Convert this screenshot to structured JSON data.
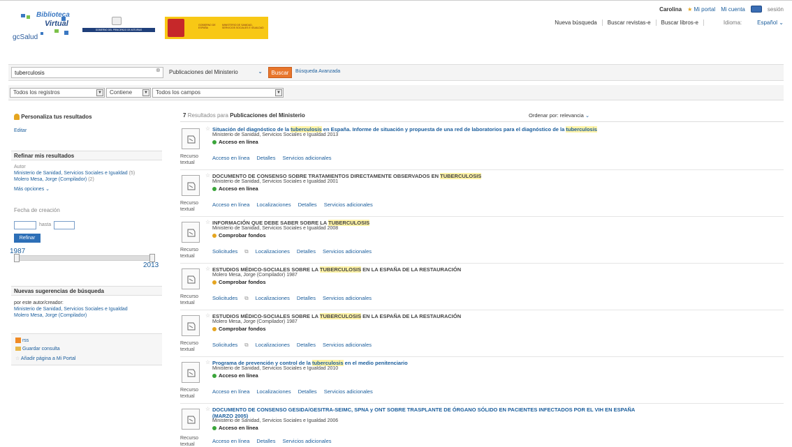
{
  "header": {
    "user": "Carolina",
    "my_portal": "Mi portal",
    "my_account": "Mi cuenta",
    "session": "sesión",
    "nav": [
      "Nueva búsqueda",
      "Buscar revistas-e",
      "Buscar libros-e"
    ],
    "language_label": "Idioma:",
    "language_value": "Español"
  },
  "logos": {
    "bv_line1": "Biblioteca",
    "bv_line2": "Virtual",
    "gcsalud": "gcSalud",
    "asturias": "GOBIERNO DEL PRINCIPADO DE ASTURIAS",
    "gobierno": "GOBIERNO DE ESPAÑA",
    "ministerio": "MINISTERIO DE SANIDAD, SERVICIOS SOCIALES E IGUALDAD"
  },
  "search": {
    "query": "tuberculosis",
    "scope": "Publicaciones del Ministerio",
    "button": "Buscar",
    "advanced": "Búsqueda Avanzada",
    "filter_records": "Todos los registros",
    "filter_op": "Contiene",
    "filter_fields": "Todos los campos"
  },
  "sidebar": {
    "personalize_title": "Personaliza tus resultados",
    "edit": "Editar",
    "refine_title": "Refinar mis resultados",
    "author_label": "Autor",
    "authors": [
      {
        "name": "Ministerio de Sanidad, Servicios Sociales e Igualdad",
        "count": "(5)"
      },
      {
        "name": "Molero Mesa, Jorge (Compilador)",
        "count": "(2)"
      }
    ],
    "more_options": "Más opciones",
    "date_label": "Fecha de creación",
    "to_label": "hasta",
    "refine_button": "Refinar",
    "year_min": "1987",
    "year_max": "2013",
    "suggestions_title": "Nuevas sugerencias de búsqueda",
    "by_author": "por este autor/creador:",
    "suggest_authors": [
      "Ministerio de Sanidad, Servicios Sociales e Igualdad",
      "Molero Mesa, Jorge (Compilador)"
    ],
    "rss": "rss",
    "save_query": "Guardar consulta",
    "add_portal": "Añadir página a Mi Portal"
  },
  "results_header": {
    "count": "7",
    "results_word": "Resultados",
    "for_word": "para",
    "scope": "Publicaciones del Ministerio",
    "sort_label": "Ordenar por:",
    "sort_value": "relevancia"
  },
  "results": [
    {
      "title_pre": "Situación del diagnóstico de la ",
      "title_hl": "tuberculosis",
      "title_post": " en España. Informe de situación y propuesta de una red de laboratorios para el diagnóstico de la ",
      "title_hl2": "tuberculosis",
      "title_post2": "",
      "author": "Ministerio de Sanidad, Servicios Sociales e Igualdad 2013",
      "avail": "Acceso en línea",
      "type": "Recurso textual",
      "actions": [
        "Acceso en línea",
        "Detalles",
        "Servicios adicionales"
      ]
    },
    {
      "title_pre": "DOCUMENTO DE CONSENSO SOBRE TRATAMIENTOS DIRECTAMENTE OBSERVADOS EN ",
      "title_hl": "TUBERCULOSIS",
      "title_post": "",
      "title_hl2": "",
      "title_post2": "",
      "author": "Ministerio de Sanidad, Servicios Sociales e Igualdad 2001",
      "avail": "Acceso en línea",
      "type": "Recurso textual",
      "actions": [
        "Acceso en línea",
        "Localizaciones",
        "Detalles",
        "Servicios adicionales"
      ]
    },
    {
      "title_pre": "INFORMACIÓN QUE DEBE SABER SOBRE LA ",
      "title_hl": "TUBERCULOSIS",
      "title_post": "",
      "title_hl2": "",
      "title_post2": "",
      "author": "Ministerio de Sanidad, Servicios Sociales e Igualdad 2008",
      "avail": "Comprobar fondos",
      "type": "Recurso textual",
      "actions": [
        "Solicitudes",
        "Localizaciones",
        "Detalles",
        "Servicios adicionales"
      ]
    },
    {
      "title_pre": "ESTUDIOS MÉDICO-SOCIALES SOBRE LA ",
      "title_hl": "TUBERCULOSIS",
      "title_post": " EN LA ESPAÑA DE LA RESTAURACIÓN",
      "title_hl2": "",
      "title_post2": "",
      "author": "Molero Mesa, Jorge (Compilador) 1987",
      "avail": "Comprobar fondos",
      "type": "Recurso textual",
      "actions": [
        "Solicitudes",
        "Localizaciones",
        "Detalles",
        "Servicios adicionales"
      ]
    },
    {
      "title_pre": "ESTUDIOS MÉDICO-SOCIALES SOBRE LA ",
      "title_hl": "TUBERCULOSIS",
      "title_post": " EN LA ESPAÑA DE LA RESTAURACIÓN",
      "title_hl2": "",
      "title_post2": "",
      "author": "Molero Mesa, Jorge (Compilador) 1987",
      "avail": "Comprobar fondos",
      "type": "Recurso textual",
      "actions": [
        "Solicitudes",
        "Localizaciones",
        "Detalles",
        "Servicios adicionales"
      ]
    },
    {
      "title_pre": "Programa de prevención y control de la ",
      "title_hl": "tuberculosis",
      "title_post": " en el medio penitenciario",
      "title_hl2": "",
      "title_post2": "",
      "author": "Ministerio de Sanidad, Servicios Sociales e Igualdad 2010",
      "avail": "Acceso en línea",
      "type": "Recurso textual",
      "actions": [
        "Acceso en línea",
        "Localizaciones",
        "Detalles",
        "Servicios adicionales"
      ]
    },
    {
      "title_pre": "DOCUMENTO DE CONSENSO GESIDA/GESITRA-SEIMC, SPNA y ONT SOBRE TRASPLANTE DE ÓRGANO SÓLIDO EN PACIENTES INFECTADOS POR EL VIH EN ESPAÑA (MARZO 2005)",
      "title_hl": "",
      "title_post": "",
      "title_hl2": "",
      "title_post2": "",
      "author": "Ministerio de Sanidad, Servicios Sociales e Igualdad 2006",
      "avail": "Acceso en línea",
      "type": "Recurso textual",
      "actions": [
        "Acceso en línea",
        "Detalles",
        "Servicios adicionales"
      ]
    }
  ],
  "colors": {
    "link": "#1a5d9c",
    "accent": "#e8762c",
    "online": "#3aa53a",
    "check": "#e5a520",
    "highlight": "#fff3a6"
  },
  "icons": [
    "star-icon",
    "document-icon",
    "chevron-down-icon",
    "rss-icon",
    "folder-icon",
    "person-icon",
    "external-link-icon"
  ]
}
